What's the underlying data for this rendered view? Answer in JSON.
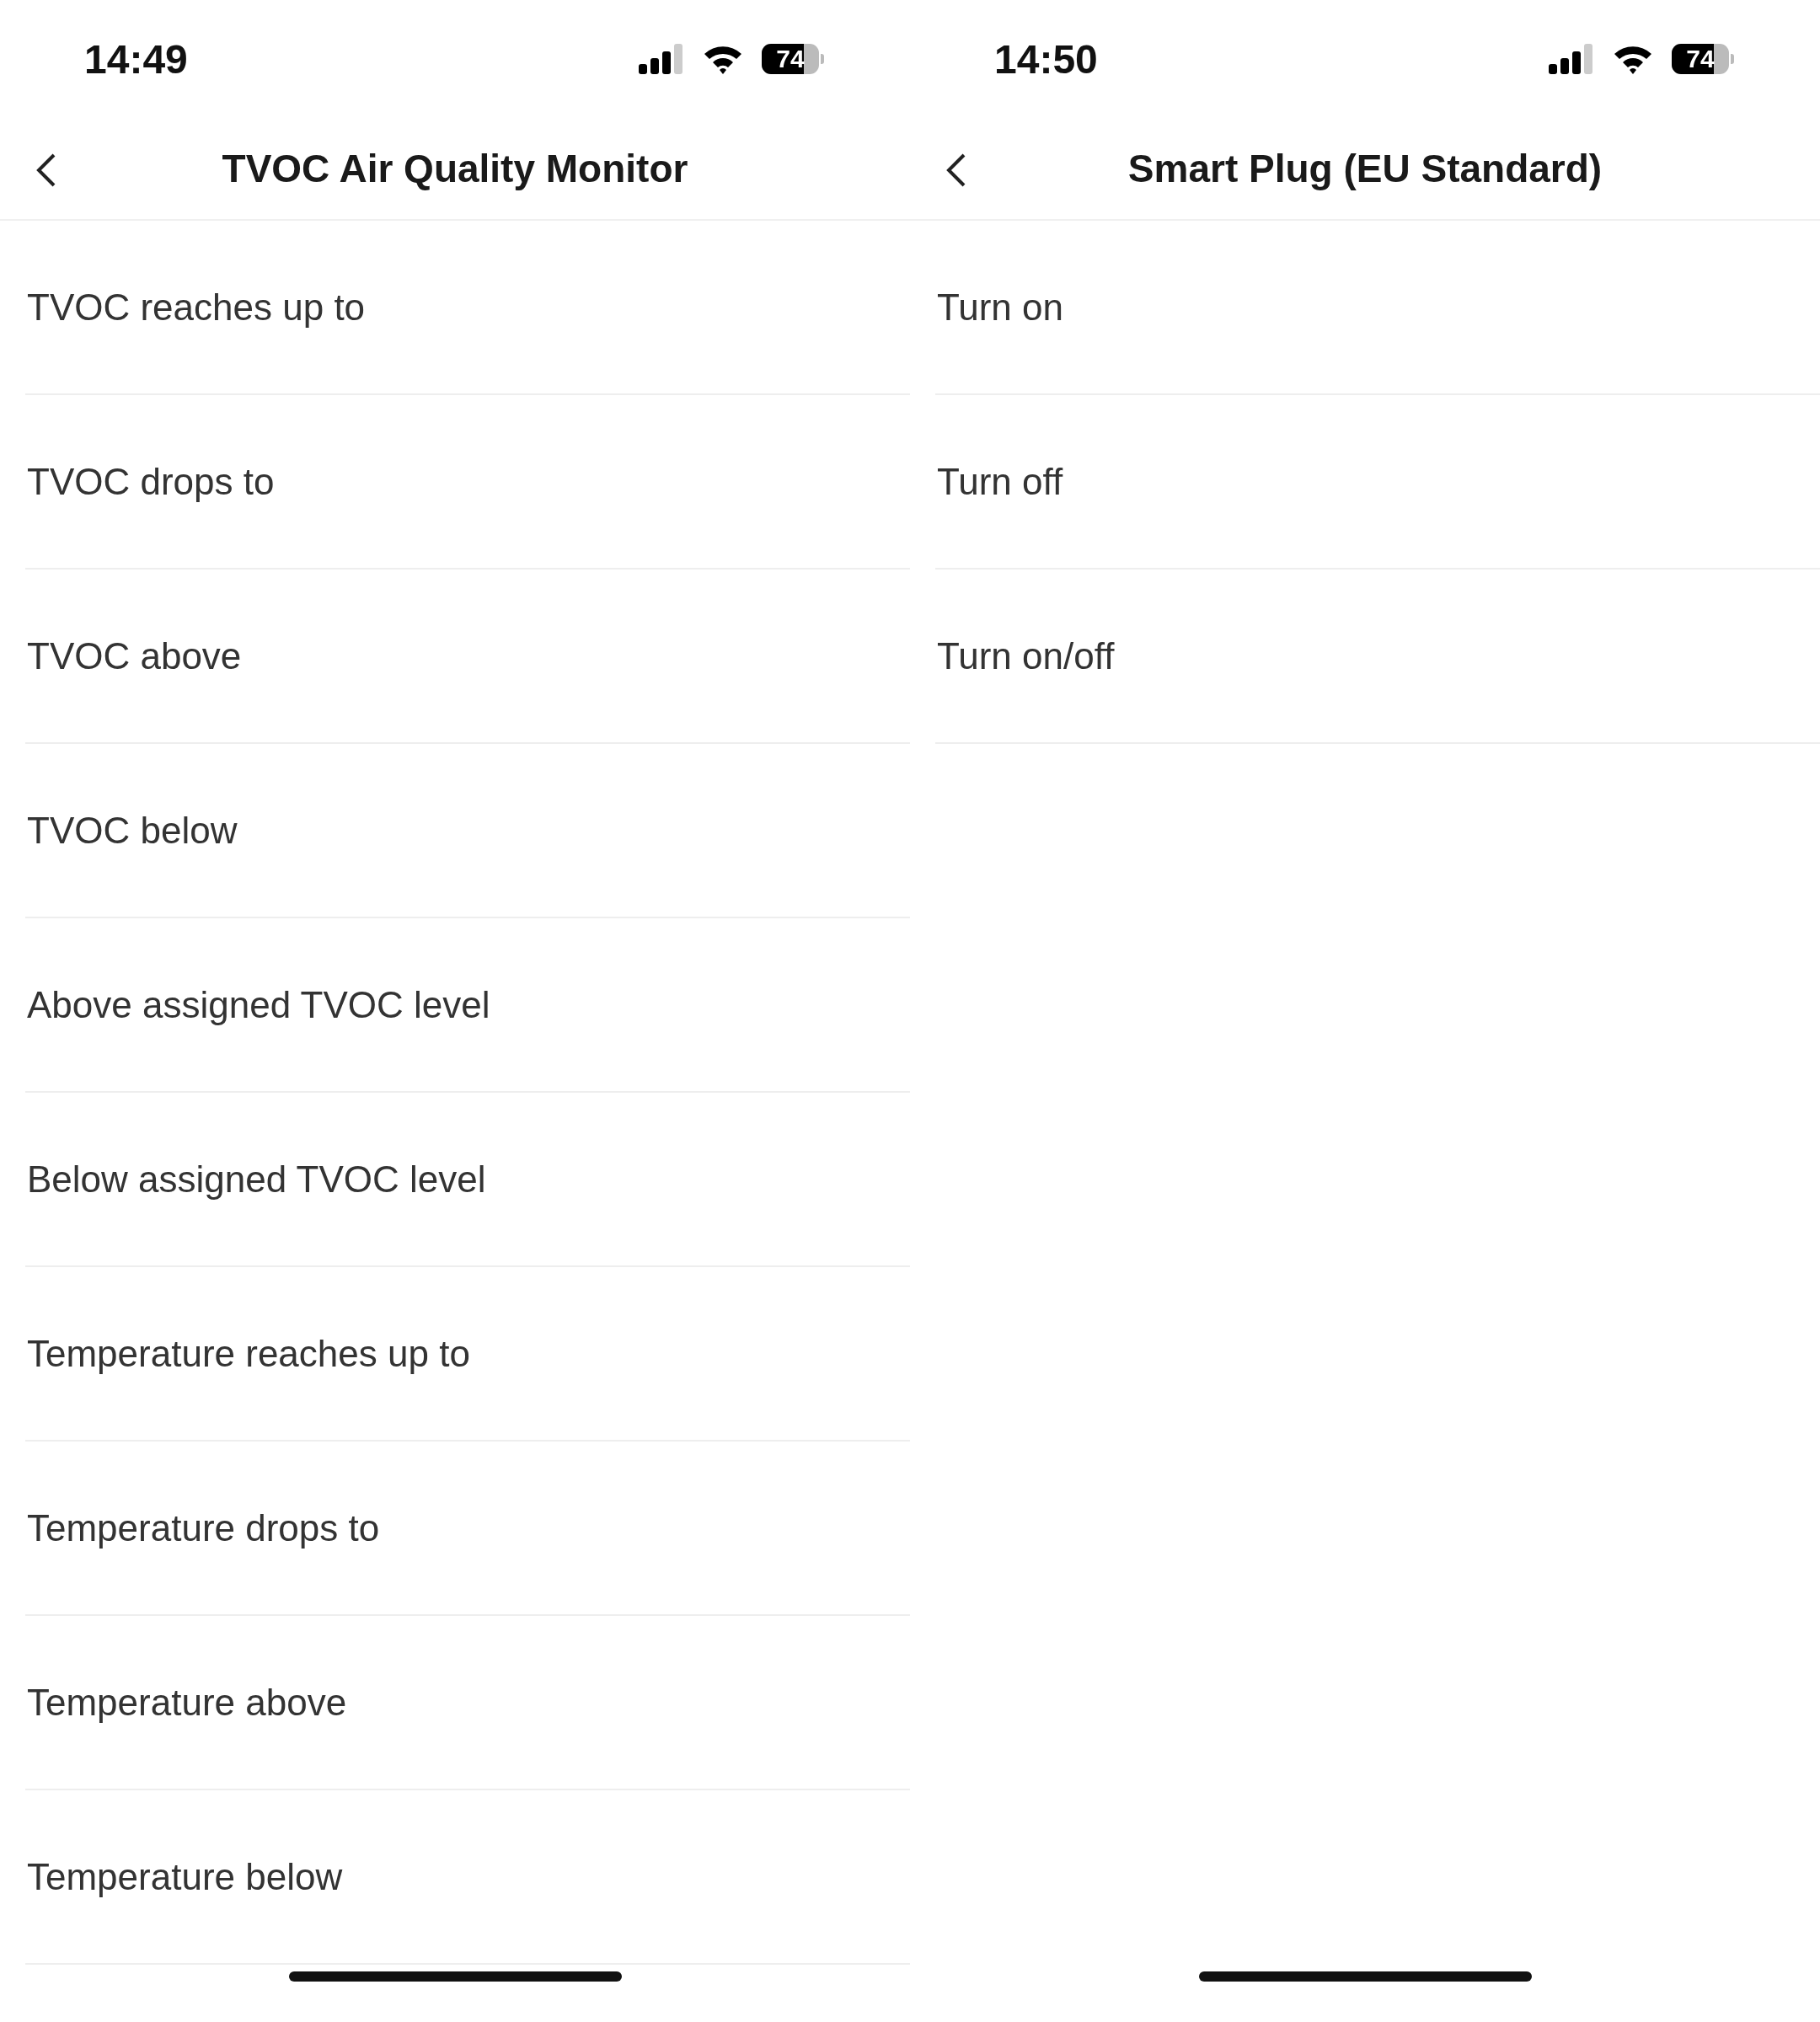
{
  "screens": [
    {
      "status_bar": {
        "time": "14:49",
        "battery": "74"
      },
      "title": "TVOC Air Quality Monitor",
      "items": [
        "TVOC reaches up to",
        "TVOC drops to",
        "TVOC above",
        "TVOC below",
        "Above assigned TVOC level",
        "Below assigned TVOC level",
        "Temperature reaches up to",
        "Temperature drops to",
        "Temperature above",
        "Temperature below"
      ]
    },
    {
      "status_bar": {
        "time": "14:50",
        "battery": "74"
      },
      "title": "Smart Plug (EU Standard)",
      "items": [
        "Turn on",
        "Turn off",
        "Turn on/off"
      ]
    }
  ]
}
